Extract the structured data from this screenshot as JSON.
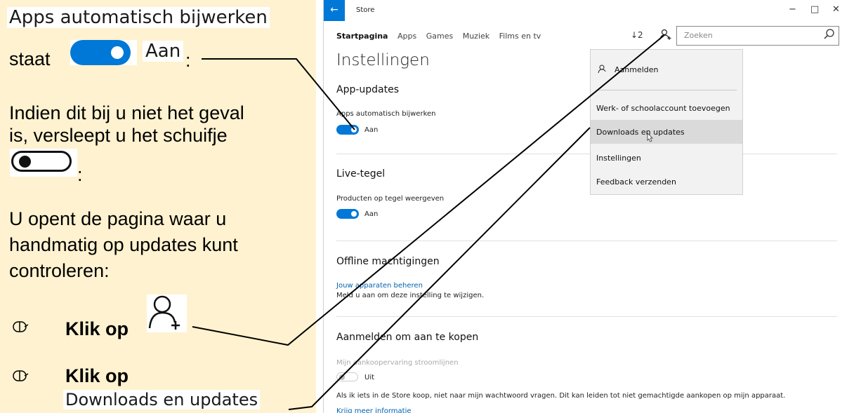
{
  "instructions": {
    "chip_auto_update": "Apps automatisch bijwerken",
    "staat": "staat",
    "chip_on": "Aan",
    "colon": ":",
    "para1_l1": "Indien dit bij u niet het geval",
    "para1_l2": "is, versleept u het schuifje",
    "para2_l1": "U opent de pagina waar u",
    "para2_l2": "handmatig op updates kunt",
    "para2_l3": "controleren:",
    "step1": "Klik op",
    "step2": "Klik op",
    "chip_downloads": "Downloads en updates"
  },
  "window": {
    "title": "Store",
    "back_icon": "←",
    "minimize": "−",
    "maximize": "□",
    "close": "✕",
    "nav": [
      "Startpagina",
      "Apps",
      "Games",
      "Muziek",
      "Films en tv"
    ],
    "downloads_badge": "↓2",
    "search_placeholder": "Zoeken"
  },
  "settings": {
    "title": "Instellingen",
    "app_updates_heading": "App-updates",
    "auto_update_label": "Apps automatisch bijwerken",
    "auto_update_state": "Aan",
    "live_tile_heading": "Live-tegel",
    "live_tile_label": "Producten op tegel weergeven",
    "live_tile_state": "Aan",
    "offline_heading": "Offline machtigingen",
    "offline_link": "Jouw apparaten beheren",
    "offline_note": "Meld u aan om deze instelling te wijzigen.",
    "purchase_heading": "Aanmelden om aan te kopen",
    "purchase_label": "Mijn aankoopervaring stroomlijnen",
    "purchase_state": "Uit",
    "purchase_note": "Als ik iets in de Store koop, niet naar mijn wachtwoord vragen. Dit kan leiden tot niet gemachtigde aankopen op mijn apparaat.",
    "more_info": "Krijg meer informatie"
  },
  "menu": {
    "items": [
      "Aanmelden",
      "Werk- of schoolaccount toevoegen",
      "Downloads en updates",
      "Instellingen",
      "Feedback verzenden"
    ],
    "highlighted": "Downloads en updates"
  },
  "colors": {
    "panel_bg": "#fff2d0",
    "accent": "#0078d7",
    "link": "#0063b1"
  }
}
